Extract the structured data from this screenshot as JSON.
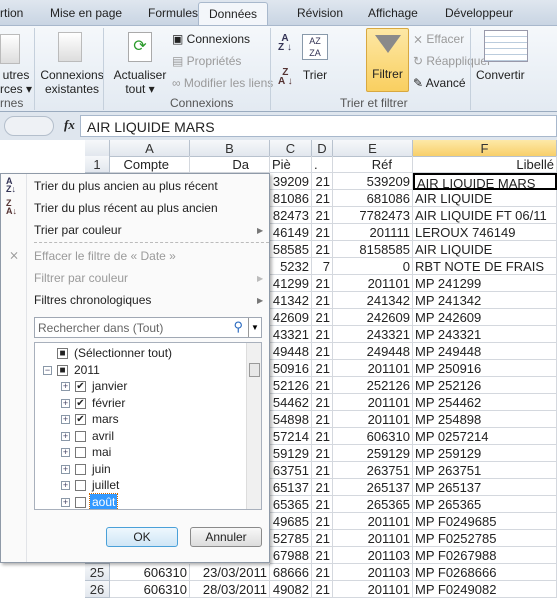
{
  "tabs": [
    "rtion",
    "Mise en page",
    "Formules",
    "Données",
    "Révision",
    "Affichage",
    "Développeur"
  ],
  "ribbon": {
    "autres": "utres",
    "sources": "rces ▾",
    "ext_group": "rnes",
    "connexions_existantes": [
      "Connexions",
      "existantes"
    ],
    "actualiser": [
      "Actualiser",
      "tout ▾"
    ],
    "connexions": "Connexions",
    "proprietes": "Propriétés",
    "modifier_liens": "Modifier les liens",
    "group_connexions": "Connexions",
    "trier": "Trier",
    "filtrer": "Filtrer",
    "effacer": "Effacer",
    "reappliquer": "Réappliquer",
    "avance": "Avancé",
    "group_trier": "Trier et filtrer",
    "convertir": "Convertir",
    "accent": "#f9cf60"
  },
  "formula": {
    "fx": "fx",
    "value": "AIR LIQUIDE MARS"
  },
  "columns": [
    "A",
    "B",
    "C",
    "D",
    "E",
    "F"
  ],
  "header_row": {
    "num": "1",
    "cells": [
      "Compte",
      "Da",
      "Piè",
      ".",
      "Réf",
      "Libellé"
    ]
  },
  "rows": [
    [
      "39209",
      "21",
      "539209",
      "AIR LIQUIDE MARS"
    ],
    [
      "81086",
      "21",
      "681086",
      "AIR LIQUIDE"
    ],
    [
      "82473",
      "21",
      "7782473",
      "AIR LIQUIDE FT 06/11"
    ],
    [
      "46149",
      "21",
      "201111",
      "LEROUX 746149"
    ],
    [
      "58585",
      "21",
      "8158585",
      "AIR LIQUIDE"
    ],
    [
      "5232",
      "7",
      "0",
      "RBT NOTE DE FRAIS"
    ],
    [
      "41299",
      "21",
      "201101",
      "MP 241299"
    ],
    [
      "41342",
      "21",
      "241342",
      "MP 241342"
    ],
    [
      "42609",
      "21",
      "242609",
      "MP 242609"
    ],
    [
      "43321",
      "21",
      "243321",
      "MP 243321"
    ],
    [
      "49448",
      "21",
      "249448",
      "MP 249448"
    ],
    [
      "50916",
      "21",
      "201101",
      "MP 250916"
    ],
    [
      "52126",
      "21",
      "252126",
      "MP 252126"
    ],
    [
      "54462",
      "21",
      "201101",
      "MP 254462"
    ],
    [
      "54898",
      "21",
      "201101",
      "MP 254898"
    ],
    [
      "57214",
      "21",
      "606310",
      "MP 0257214"
    ],
    [
      "59129",
      "21",
      "259129",
      "MP 259129"
    ],
    [
      "63751",
      "21",
      "263751",
      "MP 263751"
    ],
    [
      "65137",
      "21",
      "265137",
      "MP 265137"
    ],
    [
      "65365",
      "21",
      "265365",
      "MP 265365"
    ],
    [
      "49685",
      "21",
      "201101",
      "MP F0249685"
    ],
    [
      "52785",
      "21",
      "201101",
      "MP F0252785"
    ],
    [
      "67988",
      "21",
      "201103",
      "MP F0267988"
    ],
    [
      "68666",
      "21",
      "201103",
      "MP F0268666"
    ],
    [
      "49082",
      "21",
      "201101",
      "MP F0249082"
    ]
  ],
  "visible_rows": [
    {
      "num": "25",
      "a": "606310",
      "b": "23/03/2011"
    },
    {
      "num": "26",
      "a": "606310",
      "b": "28/03/2011"
    }
  ],
  "menu": {
    "sort_asc": "Trier du plus ancien au plus récent",
    "sort_desc": "Trier du plus récent au plus ancien",
    "sort_color": "Trier par couleur",
    "clear_filter": "Effacer le filtre de « Date »",
    "filter_color": "Filtrer par couleur",
    "date_filters": "Filtres chronologiques",
    "search_placeholder": "Rechercher dans (Tout)",
    "items": [
      {
        "label": "(Sélectionner tout)",
        "state": "partial"
      },
      {
        "label": "2011",
        "state": "partial"
      },
      {
        "label": "janvier",
        "state": "checked"
      },
      {
        "label": "février",
        "state": "checked"
      },
      {
        "label": "mars",
        "state": "checked"
      },
      {
        "label": "avril",
        "state": "unchecked"
      },
      {
        "label": "mai",
        "state": "unchecked"
      },
      {
        "label": "juin",
        "state": "unchecked"
      },
      {
        "label": "juillet",
        "state": "unchecked"
      },
      {
        "label": "août",
        "state": "unchecked",
        "selected": true
      }
    ],
    "ok": "OK",
    "cancel": "Annuler"
  }
}
